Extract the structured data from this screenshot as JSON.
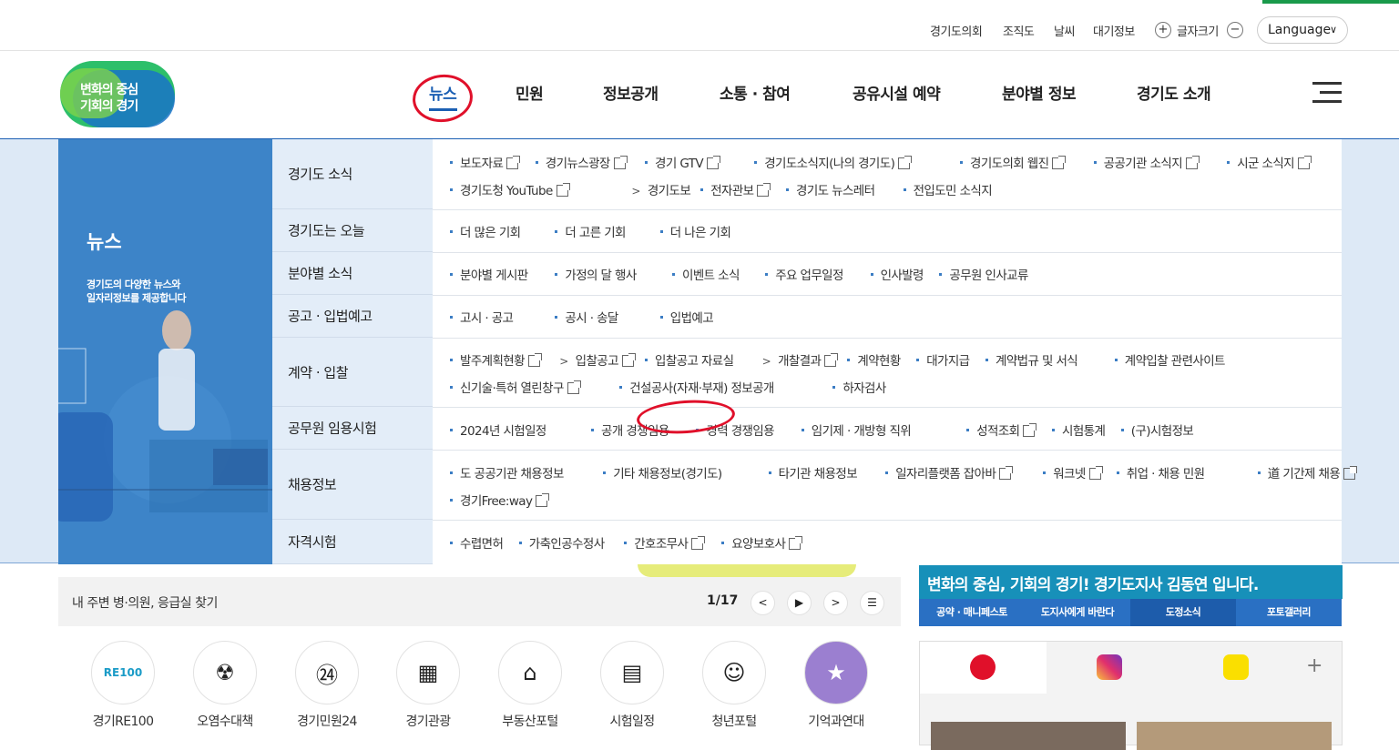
{
  "topbar": {
    "links": [
      "경기도의회",
      "조직도",
      "날씨",
      "대기정보"
    ],
    "font_size_label": "글자크기",
    "font_plus": "+",
    "font_minus": "−",
    "language": "Language"
  },
  "logo": {
    "line1": "변화의 중심",
    "line2": "기회의 경기"
  },
  "gnb": [
    "뉴스",
    "민원",
    "정보공개",
    "소통 · 참여",
    "공유시설 예약",
    "분야별 정보",
    "경기도 소개"
  ],
  "mega": {
    "title": "뉴스",
    "desc1": "경기도의 다양한 뉴스와",
    "desc2": "일자리정보를 제공합니다",
    "categories": [
      {
        "label": "경기도 소식",
        "lines": [
          [
            {
              "t": "보도자료",
              "ext": true
            },
            {
              "t": "경기뉴스광장",
              "ext": true
            },
            {
              "t": "경기 GTV",
              "ext": true
            },
            {
              "t": "경기도소식지(나의 경기도)",
              "ext": true
            },
            {
              "t": "경기도의회 웹진",
              "ext": true
            },
            {
              "t": "공공기관 소식지",
              "ext": true
            },
            {
              "t": "시군 소식지",
              "ext": true
            }
          ],
          [
            {
              "t": "경기도청 YouTube",
              "ext": true
            },
            {
              "t": "경기도보",
              "arrow": true
            },
            {
              "t": "전자관보",
              "ext": true
            },
            {
              "t": "경기도 뉴스레터"
            },
            {
              "t": "전입도민 소식지"
            }
          ]
        ]
      },
      {
        "label": "경기도는 오늘",
        "lines": [
          [
            {
              "t": "더 많은 기회"
            },
            {
              "t": "더 고른 기회"
            },
            {
              "t": "더 나은 기회"
            }
          ]
        ]
      },
      {
        "label": "분야별 소식",
        "lines": [
          [
            {
              "t": "분야별 게시판"
            },
            {
              "t": "가정의 달 행사"
            },
            {
              "t": "이벤트 소식"
            },
            {
              "t": "주요 업무일정"
            },
            {
              "t": "인사발령"
            },
            {
              "t": "공무원 인사교류"
            }
          ]
        ]
      },
      {
        "label": "공고 · 입법예고",
        "lines": [
          [
            {
              "t": "고시 · 공고"
            },
            {
              "t": "공시 · 송달"
            },
            {
              "t": "입법예고"
            }
          ]
        ]
      },
      {
        "label": "계약 · 입찰",
        "lines": [
          [
            {
              "t": "발주계획현황",
              "ext": true
            },
            {
              "t": "입찰공고",
              "arrow": true,
              "ext": true
            },
            {
              "t": "입찰공고 자료실"
            },
            {
              "t": "개찰결과",
              "arrow": true,
              "ext": true
            },
            {
              "t": "계약현황"
            },
            {
              "t": "대가지급"
            },
            {
              "t": "계약법규 및 서식"
            },
            {
              "t": "계약입찰 관련사이트"
            }
          ],
          [
            {
              "t": "신기술·특허 열린창구",
              "ext": true
            },
            {
              "t": "건설공사(자재·부재) 정보공개"
            },
            {
              "t": "하자검사"
            }
          ]
        ]
      },
      {
        "label": "공무원 임용시험",
        "lines": [
          [
            {
              "t": "2024년 시험일정"
            },
            {
              "t": "공개 경쟁임용"
            },
            {
              "t": "경력 경쟁임용"
            },
            {
              "t": "임기제 · 개방형 직위"
            },
            {
              "t": "성적조회",
              "ext": true
            },
            {
              "t": "시험통계"
            },
            {
              "t": "(구)시험정보"
            }
          ]
        ]
      },
      {
        "label": "채용정보",
        "lines": [
          [
            {
              "t": "도 공공기관 채용정보"
            },
            {
              "t": "기타 채용정보(경기도)"
            },
            {
              "t": "타기관 채용정보"
            },
            {
              "t": "일자리플랫폼 잡아바",
              "ext": true
            },
            {
              "t": "워크넷",
              "ext": true
            },
            {
              "t": "취업 · 채용 민원"
            },
            {
              "t": "道 기간제 채용",
              "ext": true
            }
          ],
          [
            {
              "t": "경기Free:way",
              "ext": true
            }
          ]
        ]
      },
      {
        "label": "자격시험",
        "lines": [
          [
            {
              "t": "수렵면허"
            },
            {
              "t": "가축인공수정사"
            },
            {
              "t": "간호조무사",
              "ext": true
            },
            {
              "t": "요양보호사",
              "ext": true
            }
          ]
        ]
      }
    ]
  },
  "notice": {
    "text": "내 주변 병·의원, 응급실 찾기",
    "count": "1/17",
    "prev": "<",
    "play": "▶",
    "next": ">",
    "list": "☰"
  },
  "quick": [
    {
      "label": "경기RE100",
      "icon": "re100-icon",
      "glyph": "RE100"
    },
    {
      "label": "오염수대책",
      "icon": "radiation-icon",
      "glyph": "☢"
    },
    {
      "label": "경기민원24",
      "icon": "civil-24-icon",
      "glyph": "㉔"
    },
    {
      "label": "경기관광",
      "icon": "tourism-icon",
      "glyph": "▦"
    },
    {
      "label": "부동산포털",
      "icon": "realestate-icon",
      "glyph": "⌂"
    },
    {
      "label": "시험일정",
      "icon": "exam-schedule-icon",
      "glyph": "▤"
    },
    {
      "label": "청년포털",
      "icon": "youth-icon",
      "glyph": "☺"
    },
    {
      "label": "기억과연대",
      "icon": "ribbon-icon",
      "glyph": "★"
    }
  ],
  "governor": {
    "banner": "변화의 중심, 기회의 경기! 경기도지사 김동연 입니다.",
    "tabs": [
      "공약 · 매니페스토",
      "도지사에게 바란다",
      "도정소식",
      "포토갤러리"
    ]
  },
  "sns": {
    "plus": "+"
  },
  "colors": {
    "brand_blue": "#1b5fb3",
    "mega_side": "#3d84c8",
    "annotation_red": "#e0102a",
    "gov_banner": "#1790b9"
  }
}
